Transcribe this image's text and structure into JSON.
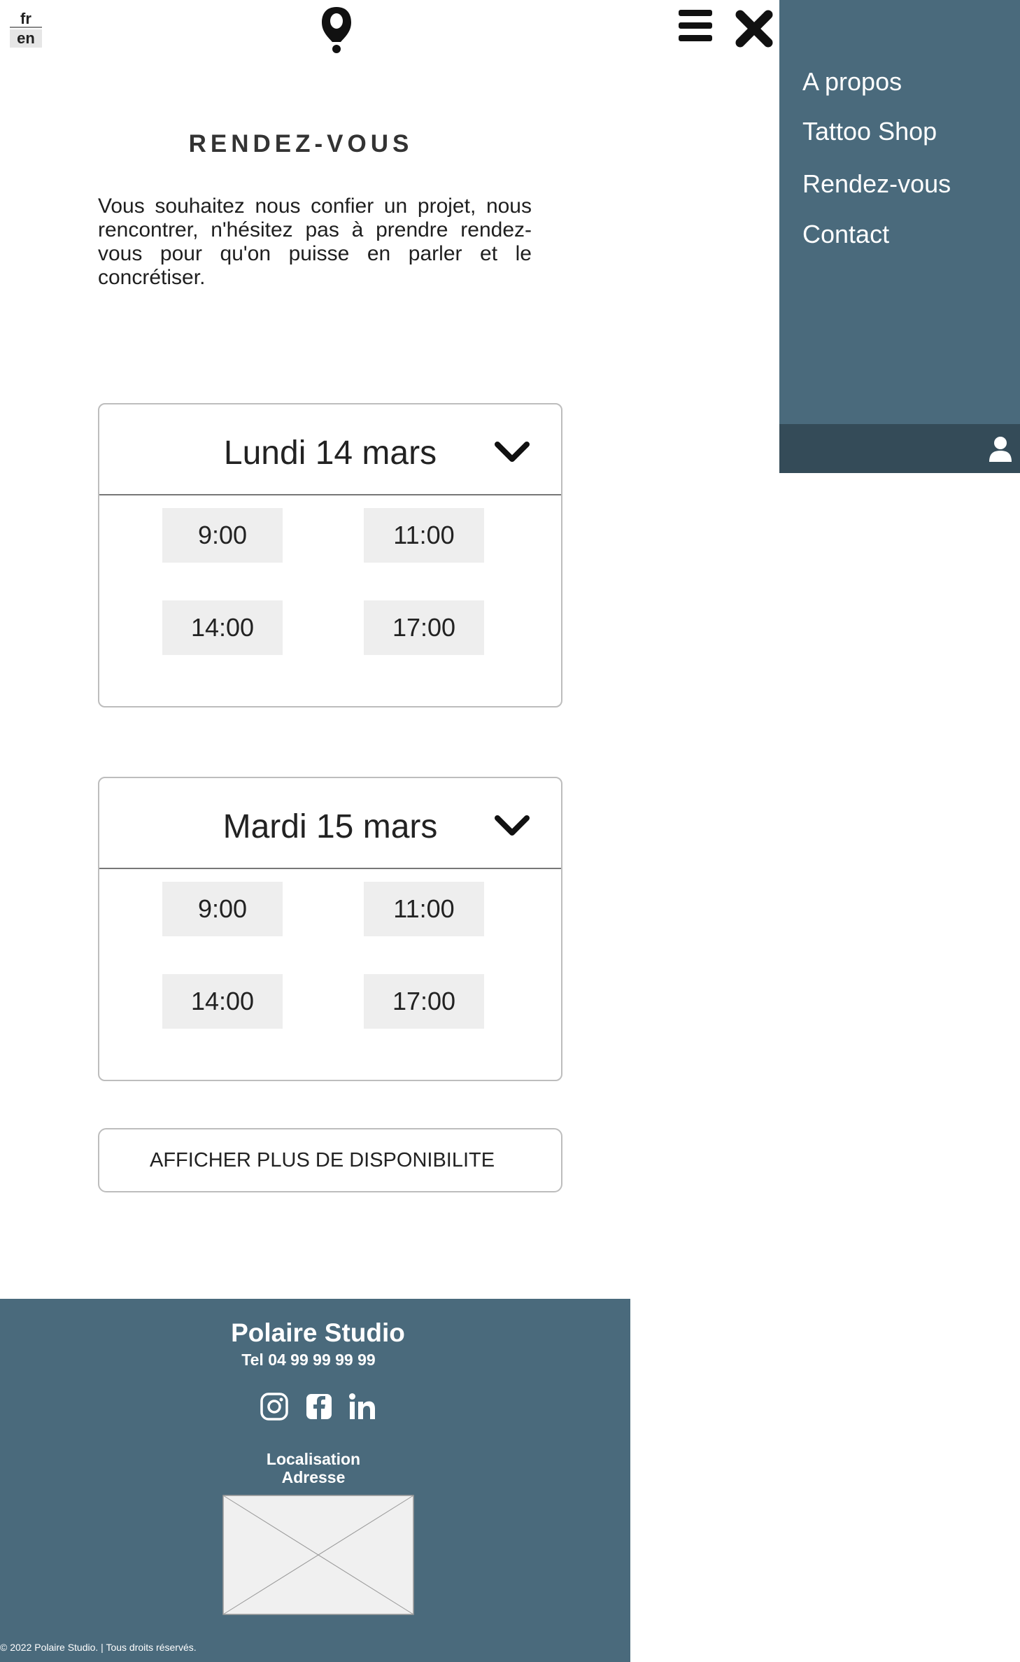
{
  "lang": {
    "fr": "fr",
    "en": "en"
  },
  "icons": {
    "logo": "location-pin-logo",
    "menu": "hamburger-icon",
    "close": "close-icon",
    "user": "user-icon",
    "chevron": "chevron-down-icon",
    "instagram": "instagram-icon",
    "facebook": "facebook-icon",
    "linkedin": "linkedin-icon",
    "map": "map-placeholder"
  },
  "colors": {
    "menu_bg": "#4a6a7c",
    "menu_footer": "#344b58",
    "footer_bg": "#4a6a7c",
    "slot_bg": "#eeeeee"
  },
  "menu": {
    "items": [
      {
        "label": "A propos"
      },
      {
        "label": "Tattoo Shop"
      },
      {
        "label": "Rendez-vous"
      },
      {
        "label": "Contact"
      }
    ]
  },
  "page": {
    "title": "RENDEZ-VOUS",
    "intro": "Vous souhaitez nous confier un projet, nous rencontrer, n'hésitez pas à prendre rendez-vous pour qu'on puisse en parler et le concrétiser."
  },
  "days": [
    {
      "label": "Lundi 14 mars",
      "slots": [
        "9:00",
        "11:00",
        "14:00",
        "17:00"
      ]
    },
    {
      "label": "Mardi 15 mars",
      "slots": [
        "9:00",
        "11:00",
        "14:00",
        "17:00"
      ]
    }
  ],
  "more_button": "AFFICHER PLUS DE DISPONIBILITE",
  "footer": {
    "studio": "Polaire Studio",
    "tel": "Tel 04 99 99 99 99",
    "localisation": "Localisation",
    "adresse": "Adresse",
    "copyright": "© 2022 Polaire Studio. | Tous droits réservés."
  }
}
